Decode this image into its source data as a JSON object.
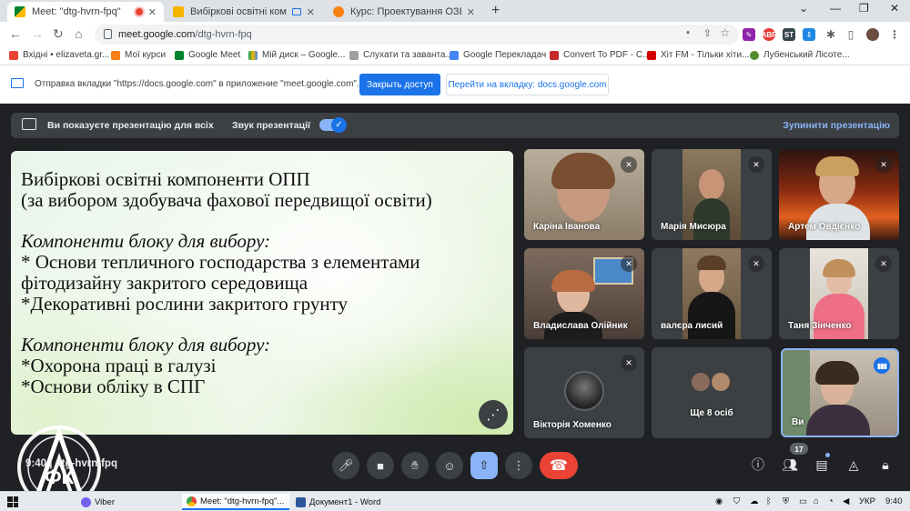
{
  "browser": {
    "tabs": [
      {
        "title": "Meet: \"dtg-hvrn-fpq\"",
        "active": true
      },
      {
        "title": "Вибіркові освітні компонен",
        "active": false
      },
      {
        "title": "Курс: Проектування ОЗБ СПГ",
        "active": false
      }
    ],
    "new_tab": "+",
    "url_host": "meet.google.com",
    "url_path": "/dtg-hvrn-fpq",
    "window_controls": [
      "⌄",
      "—",
      "❐",
      "✕"
    ],
    "ext_labels": [
      "ABP",
      "ST"
    ]
  },
  "bookmarks": [
    "Вхідні • elizaveta.gr...",
    "Мої курси",
    "Google Meet",
    "Мій диск – Google...",
    "Слухати та заванта...",
    "Google Перекладач",
    "Convert To PDF - C...",
    "Хіт FM - Тільки хіти...",
    "Лубенський Лісоте..."
  ],
  "infobar": {
    "text": "Отправка вкладки \"https://docs.google.com\" в приложение \"meet.google.com\"...",
    "primary_button": "Закрыть доступ",
    "secondary_button": "Перейти на вкладку: docs.google.com"
  },
  "presenting": {
    "status": "Ви показуєте презентацію для всіх",
    "audio_label": "Звук презентації",
    "audio_on": true,
    "stop_label": "Зупинити презентацію"
  },
  "slide": {
    "title_lines": [
      "Вибіркові освітні компоненти ОПП",
      "(за вибором здобувача фахової передвищої освіти)"
    ],
    "block1_heading": "Компоненти блоку для вибору:",
    "block1_items": [
      "* Основи тепличного господарства з елементами",
      "фітодизайну закритого середовища",
      "*Декоративні рослини закритого грунту"
    ],
    "block2_heading": "Компоненти блоку для вибору:",
    "block2_items": [
      "*Охорона праці в галузі",
      "*Основи обліку в СПГ"
    ]
  },
  "participants": [
    {
      "name": "Каріна Іванова",
      "muted": true
    },
    {
      "name": "Марія Мисюра",
      "muted": true
    },
    {
      "name": "Артем Овдієнко",
      "muted": true
    },
    {
      "name": "Владислава Олійник",
      "muted": true
    },
    {
      "name": "валєра лисий",
      "muted": true
    },
    {
      "name": "Таня Зінченко",
      "muted": true
    },
    {
      "name": "Вікторія Хоменко",
      "muted": true
    },
    {
      "name": "Ще 8 осіб",
      "muted": false
    },
    {
      "name": "Ви",
      "muted": false
    }
  ],
  "meeting": {
    "time": "9:40",
    "code": "dtg-hvrn-fpq",
    "people_count": "17"
  },
  "logo": {
    "letters": "ФК",
    "ring_text": "ЛУБЕНСЬКИЙ ЛІСОТЕХНІЧНИЙ ФАХОВИЙ КОЛЕДЖ"
  },
  "taskbar": {
    "apps": [
      "Viber",
      "Meet: \"dtg-hvrn-fpq\"...",
      "Документ1 - Word"
    ],
    "language": "УКР",
    "clock": "9:40"
  },
  "colors": {
    "meet_bg": "#202124",
    "tile_bg": "#3c4043",
    "accent_blue": "#1a73e8",
    "hangup_red": "#ea4335",
    "link_blue": "#8ab4f8"
  }
}
